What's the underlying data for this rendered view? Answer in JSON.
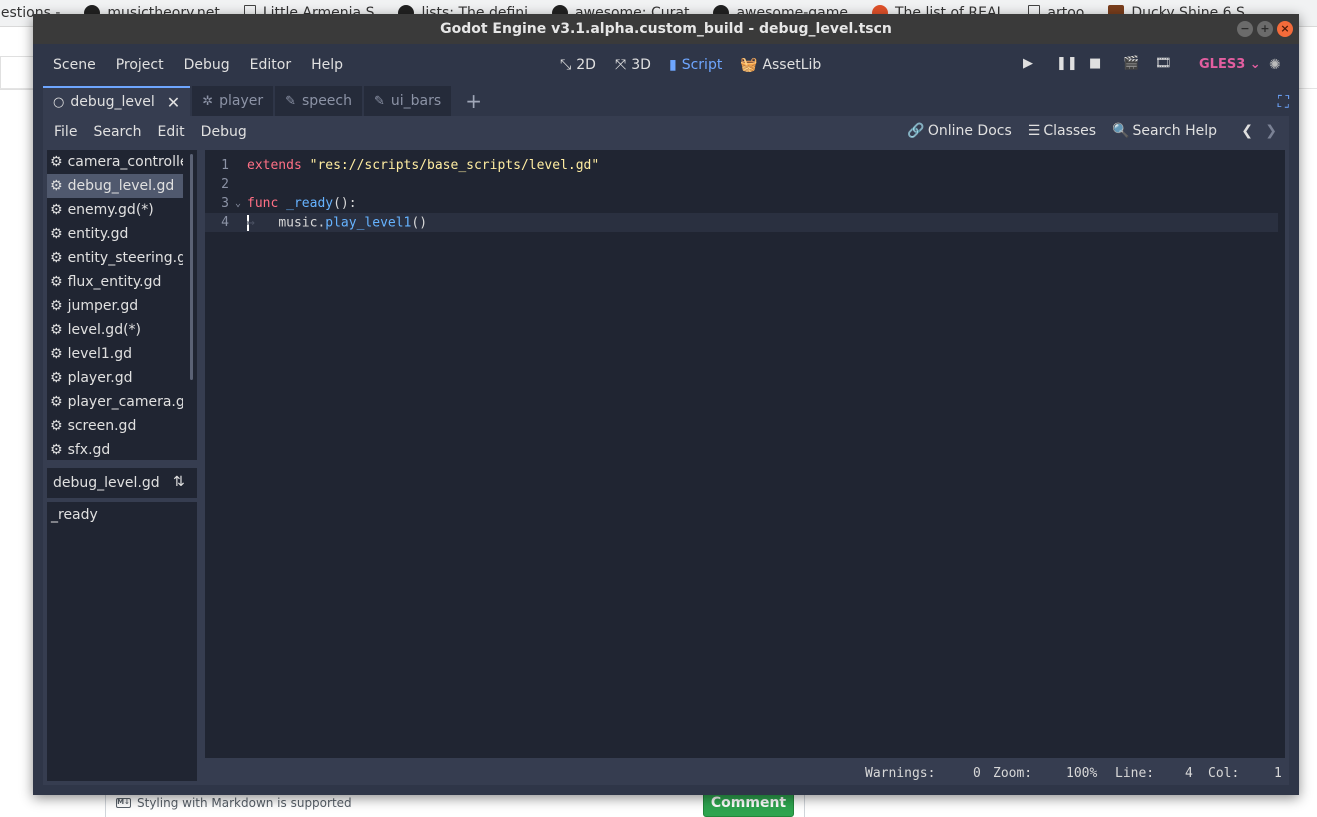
{
  "browser": {
    "bookmarks": [
      {
        "label": "uestions -",
        "icon": "none"
      },
      {
        "label": "musictheory.net",
        "icon": "github-icon"
      },
      {
        "label": "Little Armenia S",
        "icon": "document-icon"
      },
      {
        "label": "lists: The defini",
        "icon": "github-icon"
      },
      {
        "label": "awesome: Curat",
        "icon": "github-icon"
      },
      {
        "label": "awesome-game",
        "icon": "github-icon"
      },
      {
        "label": "The list of REAL",
        "icon": "reddit-icon"
      },
      {
        "label": "artoo",
        "icon": "document-icon"
      },
      {
        "label": "Ducky Shine 6 S",
        "icon": "image-icon"
      }
    ],
    "markdown_hint": "Styling with Markdown is supported",
    "markdown_icon_text": "M↓",
    "comment_button": "Comment"
  },
  "window": {
    "title": "Godot Engine v3.1.alpha.custom_build - debug_level.tscn",
    "btn_min": "−",
    "btn_max": "+",
    "btn_close": "×"
  },
  "menubar": {
    "items": [
      "Scene",
      "Project",
      "Debug",
      "Editor",
      "Help"
    ],
    "workspaces": [
      {
        "label": "2D",
        "icon": "2d-icon",
        "glyph": "⤡"
      },
      {
        "label": "3D",
        "icon": "3d-icon",
        "glyph": "⤧"
      },
      {
        "label": "Script",
        "icon": "script-icon",
        "glyph": "▮"
      },
      {
        "label": "AssetLib",
        "icon": "assetlib-icon",
        "glyph": "🧺"
      }
    ],
    "renderer": "GLES3",
    "renderer_arrow": "⌄",
    "spinner_glyph": "✺"
  },
  "tabs": [
    {
      "label": "debug_level",
      "icon": "scene-node-icon",
      "glyph": "○",
      "active": true,
      "close": "✕"
    },
    {
      "label": "player",
      "icon": "node-icon",
      "glyph": "✲",
      "active": false
    },
    {
      "label": "speech",
      "icon": "script-edit-icon",
      "glyph": "✎",
      "active": false
    },
    {
      "label": "ui_bars",
      "icon": "script-edit-icon",
      "glyph": "✎",
      "active": false
    }
  ],
  "tab_add": "+",
  "expand_glyph": "⛶",
  "script_menu": {
    "items": [
      "File",
      "Search",
      "Edit",
      "Debug"
    ],
    "help": [
      {
        "label": "Online Docs",
        "icon": "link-icon",
        "glyph": "🔗"
      },
      {
        "label": "Classes",
        "icon": "classes-icon",
        "glyph": "☰"
      },
      {
        "label": "Search Help",
        "icon": "search-help-icon",
        "glyph": "🔍"
      }
    ],
    "nav_back": "❮",
    "nav_forward": "❯"
  },
  "files": {
    "gear": "⚙",
    "items": [
      "camera_controller.gd",
      "debug_level.gd",
      "enemy.gd(*)",
      "entity.gd",
      "entity_steering.gd",
      "flux_entity.gd",
      "jumper.gd",
      "level.gd(*)",
      "level1.gd",
      "player.gd",
      "player_camera.gd",
      "screen.gd",
      "sfx.gd"
    ],
    "selected": "debug_level.gd"
  },
  "methods": {
    "script_name": "debug_level.gd",
    "sort_glyph": "⇅",
    "items": [
      "_ready"
    ]
  },
  "code": {
    "fold_glyph": "⌄",
    "lines": [
      {
        "num": "1",
        "kw": "extends",
        "str": "\"res://scripts/base_scripts/level.gd\""
      },
      {
        "num": "2"
      },
      {
        "num": "3",
        "kw": "func",
        "fn": "_ready",
        "rest": "():"
      },
      {
        "num": "4",
        "indent": "↦",
        "obj": "music.",
        "fn": "play_level1",
        "rest": "()"
      }
    ]
  },
  "status": {
    "warnings_label": "Warnings:",
    "warnings_value": "0",
    "zoom_label": "Zoom:",
    "zoom_value": "100%",
    "line_label": "Line:",
    "line_value": "4",
    "col_label": "Col:",
    "col_value": "1"
  }
}
